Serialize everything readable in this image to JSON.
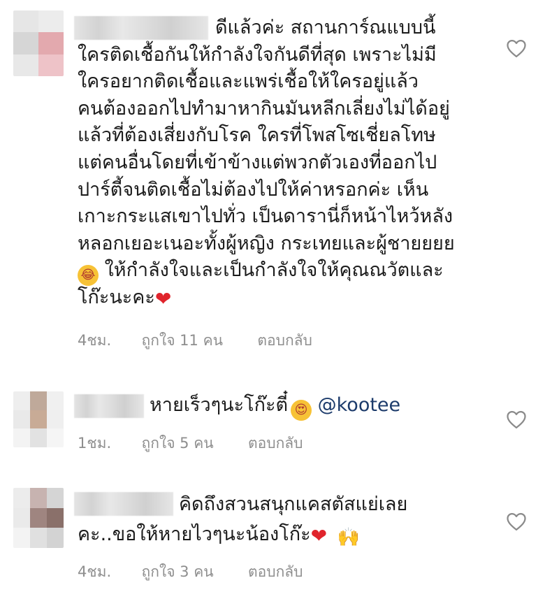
{
  "comments": [
    {
      "lines": [
        "ดีแล้วค่ะ สถานการ์ณแบบนี้",
        "ใครติดเชื้อกันให้กำลังใจกันดีที่สุด เพราะไม่มี",
        "ใครอยากติดเชื้อและแพร่เชื้อให้ใครอยู่แล้ว",
        "คนต้องออกไปทำมาหากินมันหลีกเลี่ยงไม่ได้อยู่",
        "แล้วที่ต้องเสี่ยงกับโรค ใครที่โพสโซเชี่ยลโทษ",
        "แต่คนอื่นโดยที่เข้าข้างแต่พวกตัวเองที่ออกไป",
        "ปาร์ตี้จนติดเชื้อไม่ต้องไปให้ค่าหรอกค่ะ เห็น",
        "เกาะกระแสเขาไปทั่ว เป็นดารานี่ก็หน้าไหว้หลัง",
        "หลอกเยอะเนอะทั้งผู้หญิง กระเทยและผู้ชายยยย",
        "ให้กำลังใจและเป็นกำลังใจให้คุณณวัตและ",
        "โก๊ะนะคะ"
      ],
      "emoji_laugh": "😂",
      "emoji_heart": "❤",
      "time": "4ชม.",
      "likes": "ถูกใจ 11 คน",
      "reply": "ตอบกลับ"
    },
    {
      "text": "หายเร็วๆนะโก๊ะตี๋",
      "emoji_eyes": "😍",
      "mention": "@kootee",
      "time": "1ชม.",
      "likes": "ถูกใจ 5 คน",
      "reply": "ตอบกลับ"
    },
    {
      "lines": [
        "คิดถึงสวนสนุกแคสตัสแย่เลย",
        "คะ..ขอให้หายไวๆนะน้องโก๊ะ"
      ],
      "emoji_heart": "❤",
      "emoji_hands": "🙌",
      "time": "4ชม.",
      "likes": "ถูกใจ 3 คน",
      "reply": "ตอบกลับ"
    }
  ],
  "icons": {
    "like": "heart-outline-icon"
  },
  "colors": {
    "meta_text": "#8e8e8e",
    "heart_emoji": "#e0242c",
    "mention": "#1c3b6b"
  }
}
